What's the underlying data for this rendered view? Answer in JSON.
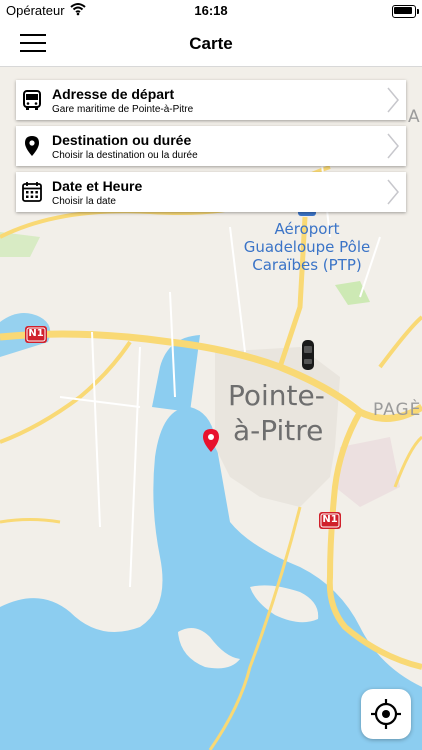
{
  "status_bar": {
    "carrier": "Opérateur",
    "time": "16:18"
  },
  "navbar": {
    "title": "Carte",
    "menu_icon": "hamburger-menu-icon"
  },
  "form_cards": [
    {
      "icon": "bus-icon",
      "title": "Adresse de départ",
      "subtitle": "Gare maritime de Pointe-à-Pitre"
    },
    {
      "icon": "location-pin-icon",
      "title": "Destination ou durée",
      "subtitle": "Choisir la destination ou la durée"
    },
    {
      "icon": "calendar-icon",
      "title": "Date et Heure",
      "subtitle": "Choisir la date"
    }
  ],
  "map": {
    "city_label_line1": "Pointe-",
    "city_label_line2": "à-Pitre",
    "airport_label_line1": "Aéroport",
    "airport_label_line2": "Guadeloupe Pôle",
    "airport_label_line3": "Caraïbes (PTP)",
    "district_label": "PAGÈ",
    "partial_label": "A",
    "road_shield_1": "N1",
    "road_shield_2": "N1",
    "colors": {
      "land": "#f2efe9",
      "water": "#8ccdf0",
      "road": "#f9d975",
      "green": "#cde9b4",
      "airport_label": "#3b74c7",
      "pin": "#e8112d",
      "shield": "#d0202b"
    }
  },
  "locate_button": {
    "icon": "crosshair-locate-icon"
  }
}
